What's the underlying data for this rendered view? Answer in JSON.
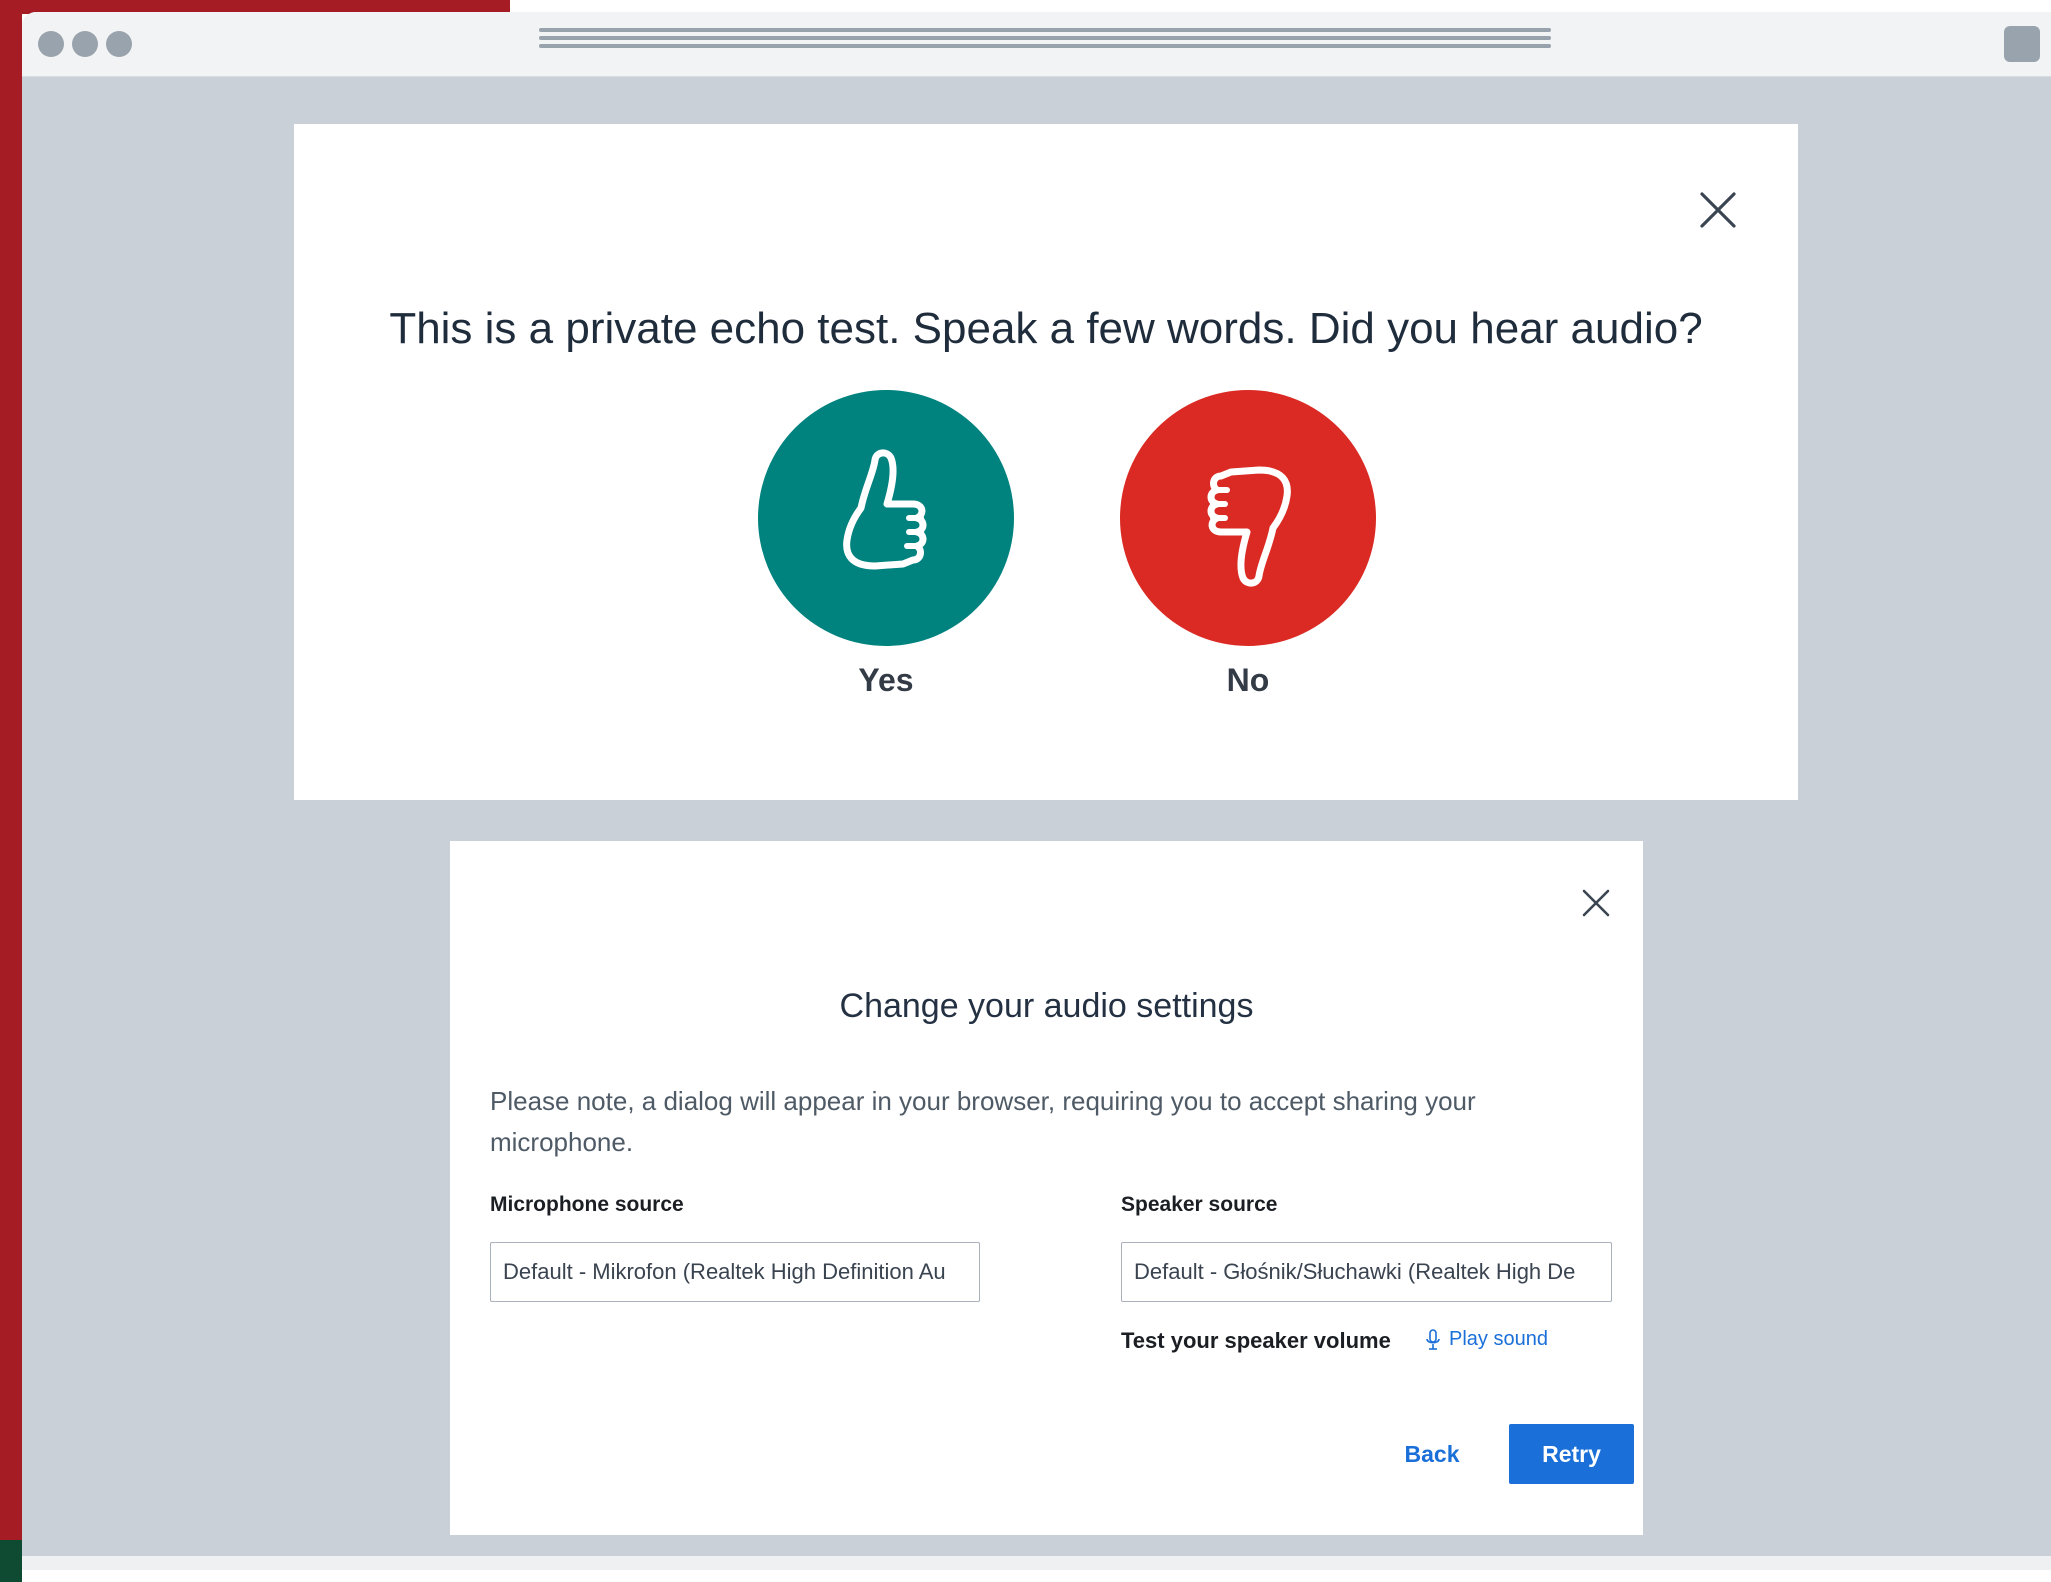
{
  "echo_dialog": {
    "title": "This is a private echo test. Speak a few words. Did you hear audio?",
    "yes_label": "Yes",
    "no_label": "No",
    "close_icon": "close-icon",
    "yes_icon": "thumbs-up-icon",
    "no_icon": "thumbs-down-icon"
  },
  "audio_dialog": {
    "title": "Change your audio settings",
    "note": "Please note, a dialog will appear in your browser, requiring you to accept sharing your microphone.",
    "microphone_label": "Microphone source",
    "microphone_value": "Default - Mikrofon (Realtek High Definition Au",
    "speaker_label": "Speaker source",
    "speaker_value": "Default - Głośnik/Słuchawki (Realtek High De",
    "test_speaker_label": "Test your speaker volume",
    "play_sound_label": "Play sound",
    "back_label": "Back",
    "retry_label": "Retry",
    "close_icon": "close-icon",
    "play_icon": "microphone-icon"
  },
  "colors": {
    "yes": "#00827f",
    "no": "#da2a23",
    "primary": "#1a6fd8",
    "backdrop": "#c9d0d8"
  }
}
